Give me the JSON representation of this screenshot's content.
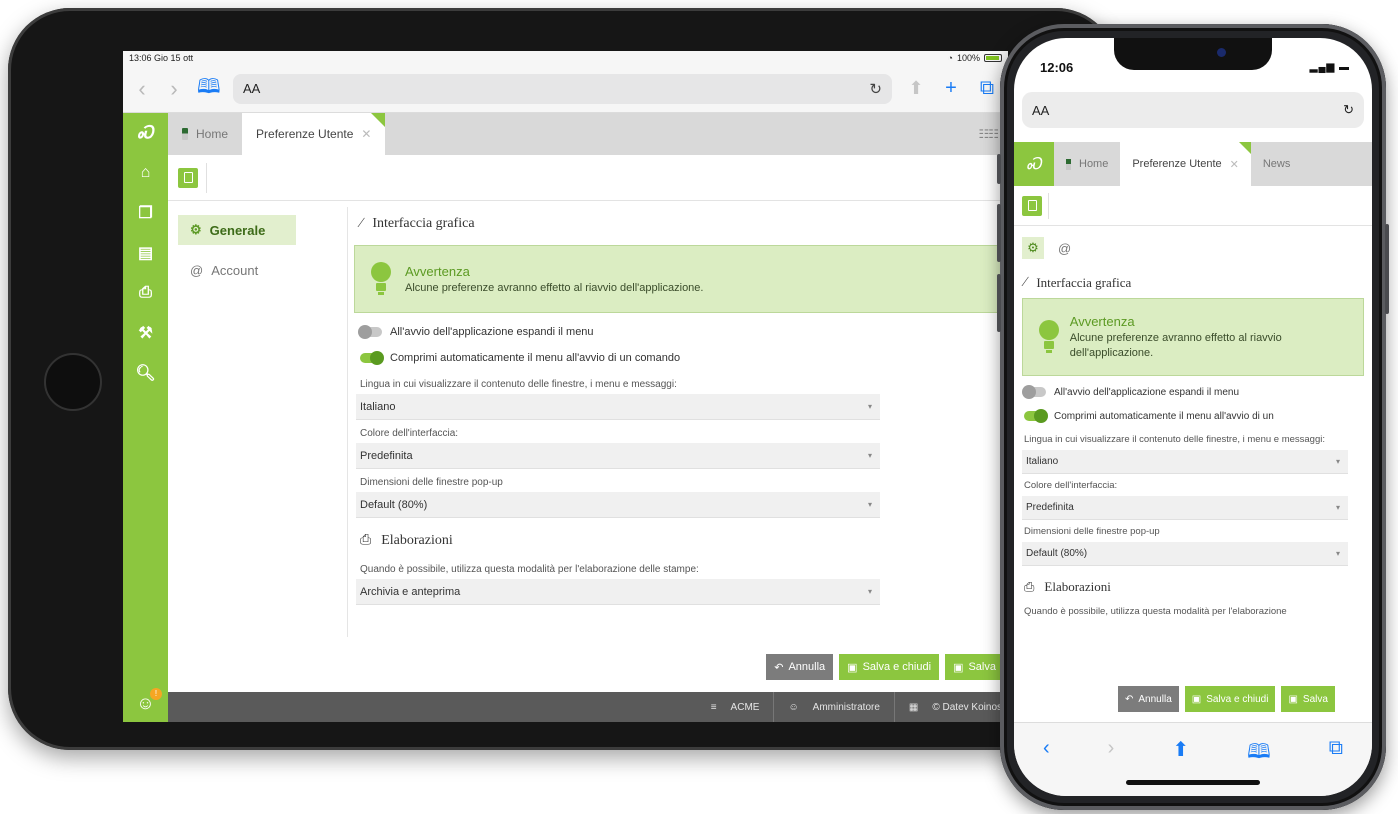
{
  "tablet": {
    "status": {
      "time": "13:06",
      "date": "Gio 15 ott",
      "battery": "100%"
    },
    "safari": {
      "aa_label": "AA"
    },
    "tabs": [
      {
        "label": "Home"
      },
      {
        "label": "Preferenze Utente"
      }
    ],
    "left_nav": [
      {
        "label": "Generale",
        "icon": "gear-icon"
      },
      {
        "label": "Account",
        "icon": "at-icon"
      }
    ],
    "bottom_bar": {
      "company": "ACME",
      "user": "Amministratore",
      "copyright": "© Datev Koinos"
    }
  },
  "prefs": {
    "section_ui": "Interfaccia grafica",
    "warning": {
      "title": "Avvertenza",
      "message": "Alcune preferenze avranno effetto al riavvio dell'applicazione."
    },
    "toggle_expand": {
      "label": "All'avvio dell'applicazione espandi il menu",
      "on": false
    },
    "toggle_collapse": {
      "label": "Comprimi automaticamente il menu all'avvio di un comando",
      "on": true
    },
    "language": {
      "label": "Lingua in cui visualizzare il contenuto delle finestre, i menu e messaggi:",
      "value": "Italiano"
    },
    "color": {
      "label": "Colore dell'interfaccia:",
      "value": "Predefinita"
    },
    "popup": {
      "label": "Dimensioni delle finestre pop-up",
      "value": "Default (80%)"
    },
    "section_proc": "Elaborazioni",
    "print": {
      "label": "Quando è possibile, utilizza questa modalità per l'elaborazione delle stampe:",
      "value": "Archivia e anteprima"
    }
  },
  "buttons": {
    "cancel": "Annulla",
    "save_close": "Salva e chiudi",
    "save": "Salva"
  },
  "phone": {
    "status": {
      "time": "12:06"
    },
    "safari": {
      "aa_label": "AA"
    },
    "tabs": [
      {
        "label": "Home"
      },
      {
        "label": "Preferenze Utente"
      },
      {
        "label": "News"
      }
    ],
    "at_symbol": "@",
    "language_label": "Lingua in cui visualizzare il contenuto delle finestre, i menu e messaggi:",
    "toggle_collapse_label": "Comprimi automaticamente il menu all'avvio di un",
    "print_label": "Quando è possibile, utilizza questa modalità per l'elaborazione"
  },
  "colors": {
    "brand_green": "#8cc63f",
    "dark_green": "#5a9a20",
    "warning_bg": "#dbedc2",
    "footer_grey": "#5a5a5a"
  }
}
